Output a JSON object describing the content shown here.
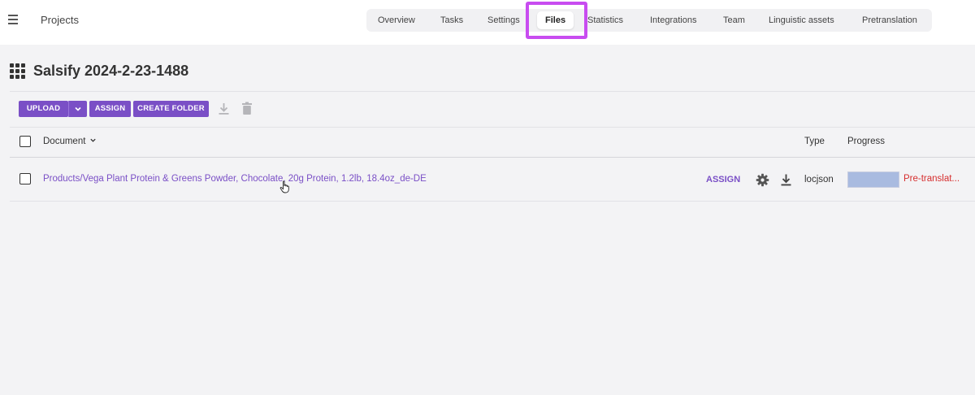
{
  "header": {
    "title": "Projects",
    "menu_icon": "hamburger-menu-icon",
    "tabs": [
      {
        "label": "Overview"
      },
      {
        "label": "Tasks"
      },
      {
        "label": "Settings"
      },
      {
        "label": "Files",
        "active": true
      },
      {
        "label": "Statistics"
      },
      {
        "label": "Integrations"
      },
      {
        "label": "Team"
      },
      {
        "label": "Linguistic assets"
      },
      {
        "label": "Pretranslation"
      }
    ],
    "highlight_color": "#c84cf0"
  },
  "project": {
    "icon": "apps-grid-icon",
    "name": "Salsify 2024-2-23-1488"
  },
  "toolbar": {
    "upload_label": "UPLOAD",
    "assign_label": "ASSIGN",
    "create_folder_label": "CREATE FOLDER",
    "icons": [
      "chevron-down-icon",
      "download-icon",
      "trash-icon"
    ],
    "accent_color": "#7a4fc6"
  },
  "table": {
    "columns": {
      "document": "Document",
      "type": "Type",
      "progress": "Progress"
    },
    "rows": [
      {
        "document": "Products/Vega Plant Protein & Greens Powder, Chocolate, 20g Protein, 1.2lb, 18.4oz_de-DE",
        "action": "ASSIGN",
        "type": "locjson",
        "progress_fraction": 1.0,
        "status": "Pre-translat...",
        "status_color": "#d62e2e"
      }
    ]
  }
}
